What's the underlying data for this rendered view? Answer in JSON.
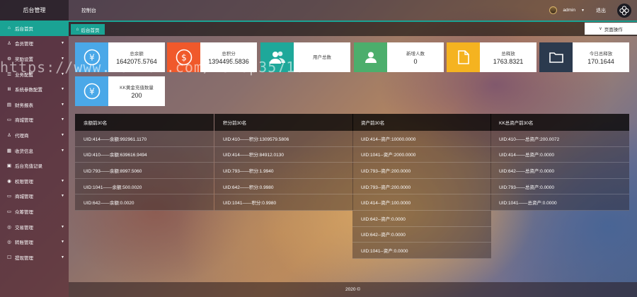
{
  "brand": "后台管理",
  "top_nav": "控制台",
  "user": {
    "name": "admin",
    "logout": "退出"
  },
  "sidebar": {
    "items": [
      {
        "label": "后台首页",
        "icon": "⌂",
        "icon_name": "home-icon",
        "has_arrow": false
      },
      {
        "label": "会员管理",
        "icon": "♙",
        "icon_name": "user-icon",
        "has_arrow": true
      },
      {
        "label": "奖励设置",
        "icon": "⚙",
        "icon_name": "gear-icon",
        "has_arrow": true
      },
      {
        "label": "业务配置",
        "icon": "☰",
        "icon_name": "list-icon",
        "has_arrow": true
      },
      {
        "label": "系统参数配置",
        "icon": "Ⅲ",
        "icon_name": "sliders-icon",
        "has_arrow": true
      },
      {
        "label": "财务报表",
        "icon": "▤",
        "icon_name": "report-icon",
        "has_arrow": true
      },
      {
        "label": "商城管理",
        "icon": "▭",
        "icon_name": "shop-icon",
        "has_arrow": true
      },
      {
        "label": "代理商",
        "icon": "♙",
        "icon_name": "agent-icon",
        "has_arrow": true
      },
      {
        "label": "收货信息",
        "icon": "▦",
        "icon_name": "address-icon",
        "has_arrow": true
      },
      {
        "label": "后台充值记录",
        "icon": "▣",
        "icon_name": "recharge-icon",
        "has_arrow": false
      },
      {
        "label": "权限管理",
        "icon": "◉",
        "icon_name": "shield-icon",
        "has_arrow": true
      },
      {
        "label": "商城管理",
        "icon": "▭",
        "icon_name": "store-icon",
        "has_arrow": true
      },
      {
        "label": "众筹管理",
        "icon": "▭",
        "icon_name": "crowdfund-icon",
        "has_arrow": false
      },
      {
        "label": "交易管理",
        "icon": "◎",
        "icon_name": "trade-icon",
        "has_arrow": true
      },
      {
        "label": "转账管理",
        "icon": "◎",
        "icon_name": "transfer-icon",
        "has_arrow": true
      },
      {
        "label": "提现管理",
        "icon": "☐",
        "icon_name": "withdraw-icon",
        "has_arrow": true
      }
    ]
  },
  "tabs": {
    "home_label": "后台首页",
    "page_ops": "页面操作"
  },
  "cards": [
    {
      "label": "总余额",
      "value": "1642075.5764",
      "color": "#4aa8e8",
      "icon": "¥",
      "icon_name": "yen-icon"
    },
    {
      "label": "总积分",
      "value": "1394495.5836",
      "color": "#f0592b",
      "icon": "$",
      "icon_name": "dollar-icon"
    },
    {
      "label": "用户总数",
      "value": "",
      "color": "#1ea89a",
      "icon": "users",
      "icon_name": "users-icon"
    },
    {
      "label": "新增人数",
      "value": "0",
      "color": "#4cae6c",
      "icon": "user",
      "icon_name": "user-add-icon"
    },
    {
      "label": "总释放",
      "value": "1763.8321",
      "color": "#f5b320",
      "icon": "file",
      "icon_name": "file-icon"
    },
    {
      "label": "今日总释放",
      "value": "170.1644",
      "color": "#2b3a4e",
      "icon": "folder",
      "icon_name": "folder-icon"
    },
    {
      "label": "KK黄金充值数量",
      "value": "200",
      "color": "#4aa8e8",
      "icon": "¥",
      "icon_name": "yen-icon"
    }
  ],
  "tables": [
    {
      "title": "余额前30名",
      "rows": [
        "UID:414——余额:992961.1170",
        "UID:410——余额:639616.9494",
        "UID:793——余额:8997.5060",
        "UID:1041——余额:500.0020",
        "UID:642——余额:0.0020"
      ]
    },
    {
      "title": "积分前30名",
      "rows": [
        "UID:410——积分:1309579.5806",
        "UID:414——积分:84912.0130",
        "UID:793——积分:1.9940",
        "UID:642——积分:0.9980",
        "UID:1041——积分:0.9980"
      ]
    },
    {
      "title": "资产前30名",
      "rows": [
        "UID:414--资产:10000.0000",
        "UID:1041--资产:2000.0000",
        "UID:793--资产:200.0000",
        "UID:793--资产:200.0000",
        "UID:414--资产:100.0000",
        "UID:642--资产:0.0000",
        "UID:642--资产:0.0000",
        "UID:1041--资产:0.0000"
      ]
    },
    {
      "title": "KK总资产前30名",
      "rows": [
        "UID:410——总资产:200.0072",
        "UID:414——总资产:0.0000",
        "UID:642——总资产:0.0000",
        "UID:793——总资产:0.0000",
        "UID:1041——总资产:0.0000"
      ]
    }
  ],
  "footer": "2020 ©",
  "watermark": "https://www.huzhan.com/ishop35710"
}
